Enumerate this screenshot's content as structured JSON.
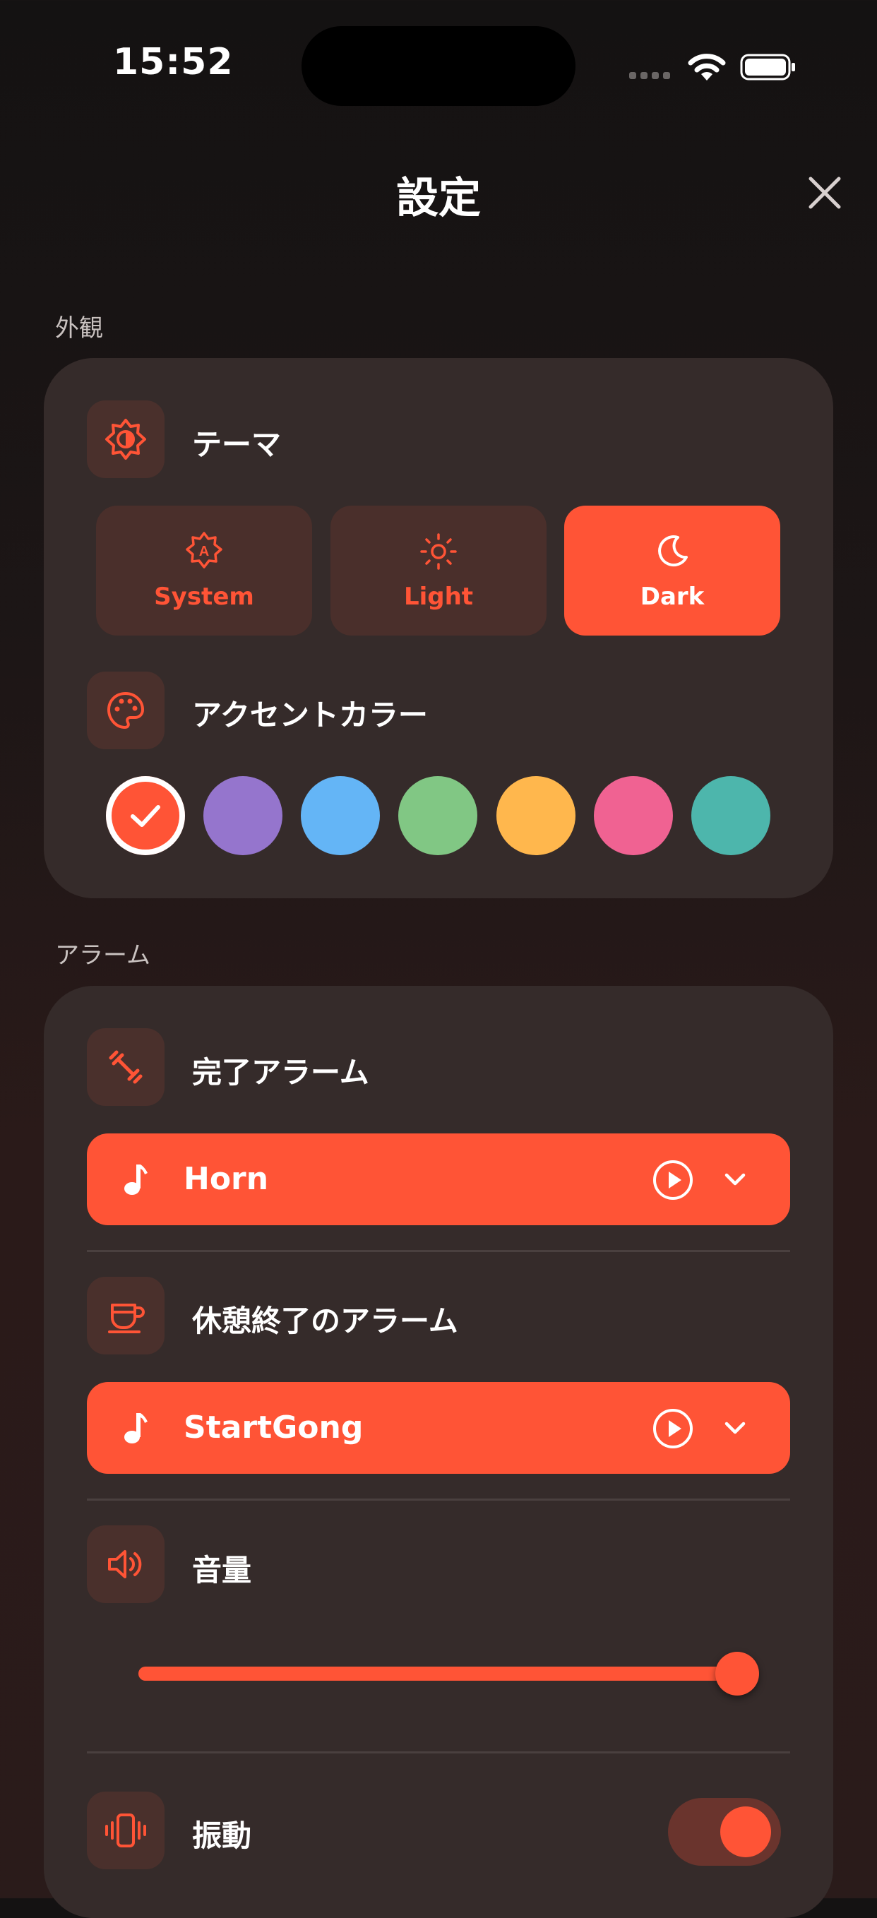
{
  "status_bar": {
    "time": "15:52"
  },
  "header": {
    "title": "設定"
  },
  "appearance": {
    "section_label": "外観",
    "theme": {
      "label": "テーマ",
      "options": [
        "System",
        "Light",
        "Dark"
      ],
      "selected": "Dark"
    },
    "accent": {
      "label": "アクセントカラー",
      "colors": [
        "#ff5436",
        "#9575cd",
        "#64b5f6",
        "#81c784",
        "#ffb74d",
        "#f06292",
        "#4db6ac"
      ],
      "selected_index": 0
    }
  },
  "alarm": {
    "section_label": "アラーム",
    "finish_alarm": {
      "label": "完了アラーム",
      "sound": "Horn"
    },
    "break_end_alarm": {
      "label": "休憩終了のアラーム",
      "sound": "StartGong"
    },
    "volume": {
      "label": "音量",
      "value": 1.0
    },
    "vibration": {
      "label": "振動",
      "enabled": true
    }
  },
  "colors": {
    "accent": "#ff5436",
    "card": "#352b2a",
    "tile": "#4a302c"
  }
}
